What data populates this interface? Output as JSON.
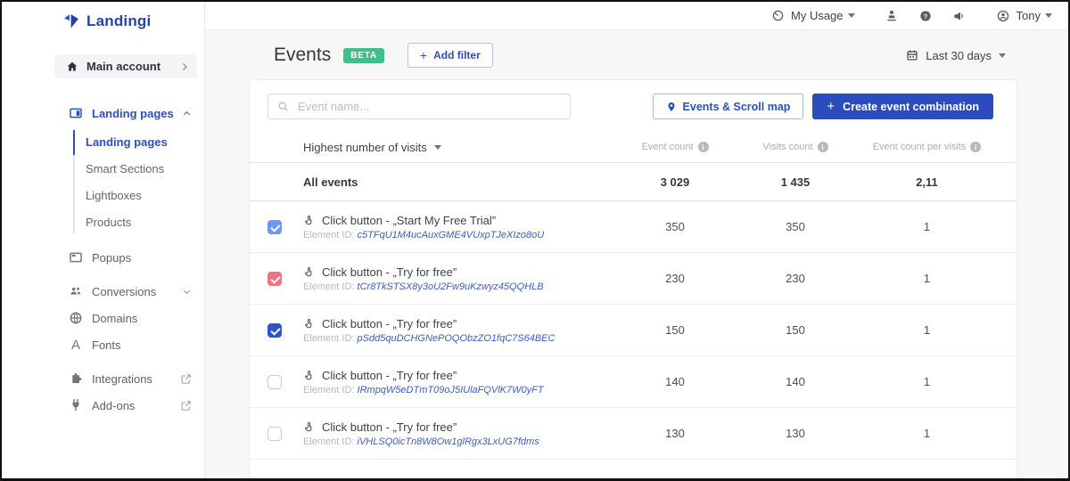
{
  "brand": {
    "name": "Landingi"
  },
  "topbar": {
    "my_usage_label": "My Usage",
    "user_name": "Tony"
  },
  "sidebar": {
    "main_account_label": "Main account",
    "landing_pages_group_label": "Landing pages",
    "sub_items": {
      "landing_pages": "Landing pages",
      "smart_sections": "Smart Sections",
      "lightboxes": "Lightboxes",
      "products": "Products"
    },
    "popups_label": "Popups",
    "conversions_label": "Conversions",
    "domains_label": "Domains",
    "fonts_label": "Fonts",
    "integrations_label": "Integrations",
    "addons_label": "Add-ons",
    "fonts_icon_glyph": "A"
  },
  "page": {
    "title": "Events",
    "beta_badge": "BETA",
    "add_filter": {
      "plus": "+",
      "label": "Add filter"
    },
    "date_range_label": "Last 30 days"
  },
  "toolbar": {
    "search_placeholder": "Event name...",
    "events_scroll_map_label": "Events & Scroll map",
    "create_event_combination": {
      "plus": "+",
      "label": "Create event combination"
    }
  },
  "table": {
    "sort_label": "Highest number of visits",
    "columns": [
      "Event count",
      "Visits count",
      "Event count per visits"
    ],
    "element_id_label": "Element ID:",
    "summary": {
      "label": "All events",
      "event_count": "3 029",
      "visits_count": "1 435",
      "event_count_per_visits": "2,11"
    },
    "rows": [
      {
        "title": "Click button - „Start My Free Trial”",
        "element_id": "c5TFqU1M4ucAuxGME4VUxpTJeXIzo8oU",
        "event_count": "350",
        "visits_count": "350",
        "event_count_per_visits": "1",
        "checked": true,
        "checkbox_color": "#6d96f2"
      },
      {
        "title": "Click button - „Try for free”",
        "element_id": "tCr8TkSTSX8y3oU2Fw9uKzwyz45QQHLB",
        "event_count": "230",
        "visits_count": "230",
        "event_count_per_visits": "1",
        "checked": true,
        "checkbox_color": "#ee7384"
      },
      {
        "title": "Click button - „Try for free”",
        "element_id": "pSdd5quDCHGNePOQObzZO1fqC7S64BEC",
        "event_count": "150",
        "visits_count": "150",
        "event_count_per_visits": "1",
        "checked": true,
        "checkbox_color": "#2d53c8"
      },
      {
        "title": "Click button - „Try for free”",
        "element_id": "IRmpqW5eDTmT09oJ5IUlaFQVlK7W0yFT",
        "event_count": "140",
        "visits_count": "140",
        "event_count_per_visits": "1",
        "checked": false,
        "checkbox_color": ""
      },
      {
        "title": "Click button - „Try for free”",
        "element_id": "iVHLSQ0icTn8W8Ow1glRgx3LxUG7fdms",
        "event_count": "130",
        "visits_count": "130",
        "event_count_per_visits": "1",
        "checked": false,
        "checkbox_color": ""
      }
    ]
  },
  "colors": {
    "accent_blue": "#2b4fc3",
    "beta_green": "#3ec08d"
  }
}
